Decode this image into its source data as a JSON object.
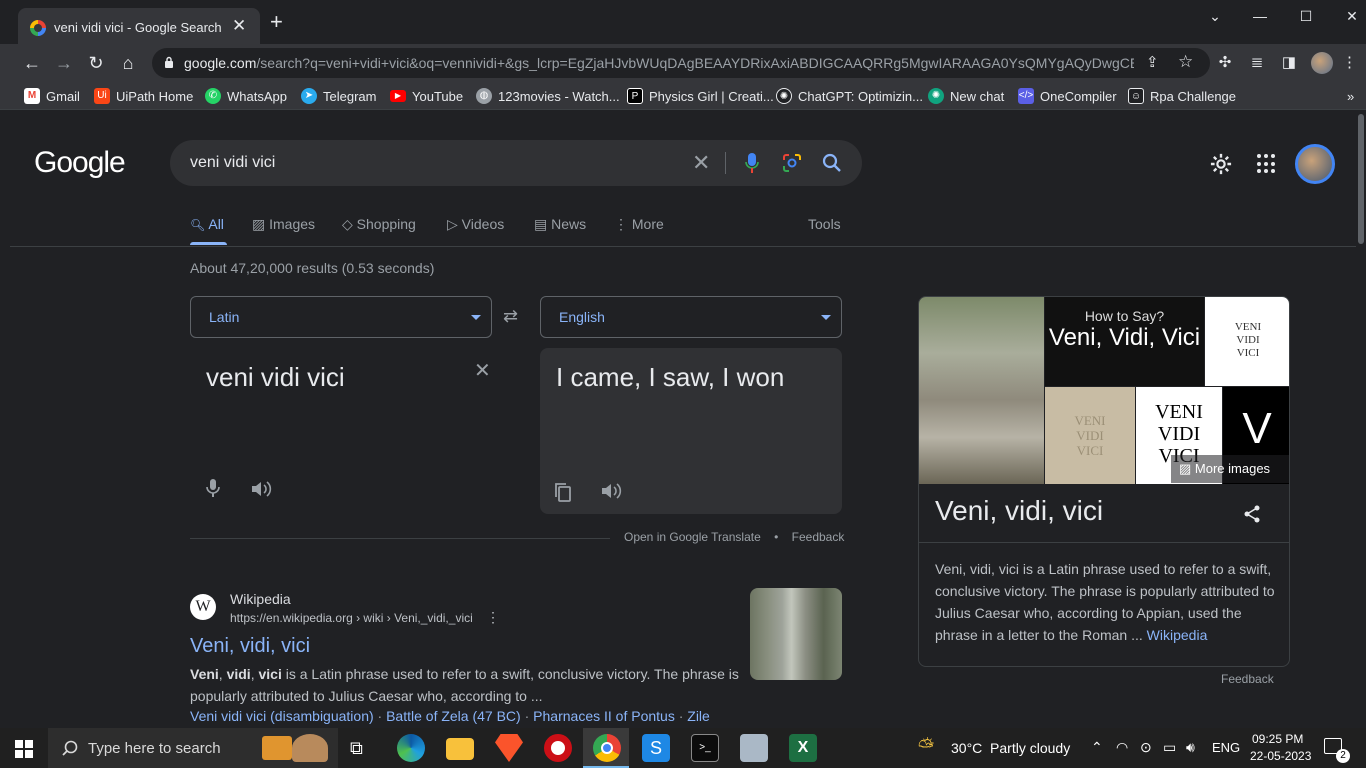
{
  "browser": {
    "tab_title": "veni vidi vici - Google Search",
    "url_host": "google.com",
    "url_path": "/search?q=veni+vidi+vici&oq=vennividi+&gs_lcrp=EgZjaHJvbWUqDAgBEAAYDRixAxiABDIGCAAQRRg5MgwIARAAGA0YsQMYgAQyDwgCEA..."
  },
  "bookmarks": [
    {
      "label": "Gmail",
      "icon": "gmail-icon",
      "color": "#ea4335"
    },
    {
      "label": "UiPath Home",
      "icon": "uipath-icon",
      "color": "#fa4616"
    },
    {
      "label": "WhatsApp",
      "icon": "whatsapp-icon",
      "color": "#25d366"
    },
    {
      "label": "Telegram",
      "icon": "telegram-icon",
      "color": "#2aabee"
    },
    {
      "label": "YouTube",
      "icon": "youtube-icon",
      "color": "#ff0000"
    },
    {
      "label": "123movies - Watch...",
      "icon": "globe-icon",
      "color": "#9aa0a6"
    },
    {
      "label": "Physics Girl | Creati...",
      "icon": "patreon-icon",
      "color": "#000000"
    },
    {
      "label": "ChatGPT: Optimizin...",
      "icon": "openai-icon",
      "color": "#202124"
    },
    {
      "label": "New chat",
      "icon": "openai-icon",
      "color": "#10a37f"
    },
    {
      "label": "OneCompiler",
      "icon": "code-icon",
      "color": "#5b5fe6"
    },
    {
      "label": "Rpa Challenge",
      "icon": "robot-icon",
      "color": "#202124"
    }
  ],
  "logo": "Google",
  "search": {
    "query": "veni vidi vici"
  },
  "tabs": [
    {
      "label": "All",
      "icon": "search-icon"
    },
    {
      "label": "Images",
      "icon": "image-icon"
    },
    {
      "label": "Shopping",
      "icon": "tag-icon"
    },
    {
      "label": "Videos",
      "icon": "play-icon"
    },
    {
      "label": "News",
      "icon": "news-icon"
    },
    {
      "label": "More",
      "icon": "more-vert-icon"
    }
  ],
  "tools_label": "Tools",
  "stats": "About 47,20,000 results (0.53 seconds)",
  "translate": {
    "source_lang": "Latin",
    "target_lang": "English",
    "source_text": "veni vidi vici",
    "target_text": "I came, I saw, I won",
    "open_link": "Open in Google Translate",
    "dot": "•",
    "feedback": "Feedback"
  },
  "result": {
    "site": "Wikipedia",
    "url": "https://en.wikipedia.org › wiki › Veni,_vidi,_vici",
    "title": "Veni, vidi, vici",
    "snippet_b1": "Veni",
    "snippet_c1": ", ",
    "snippet_b2": "vidi",
    "snippet_c2": ", ",
    "snippet_b3": "vici",
    "snippet_rest": " is a Latin phrase used to refer to a swift, conclusive victory. The phrase is popularly attributed to Julius Caesar who, according to ...",
    "links": [
      "Veni vidi vici (disambiguation)",
      "Battle of Zela (47 BC)",
      "Pharnaces II of Pontus",
      "Zile"
    ],
    "link_sep": "·"
  },
  "knowledge_panel": {
    "img_how": "How to Say?",
    "img_title": "Veni, Vidi, Vici",
    "img_badge_lines": [
      "VENI",
      "VIDI",
      "VICI"
    ],
    "img_stone": [
      "VENI",
      "VIDI",
      "VICI"
    ],
    "img_big": [
      "VENI",
      "VIDI",
      "VICI"
    ],
    "more_images": "More images",
    "title": "Veni, vidi, vici",
    "description": "Veni, vidi, vici is a Latin phrase used to refer to a swift, conclusive victory. The phrase is popularly attributed to Julius Caesar who, according to Appian, used the phrase in a letter to the Roman ... ",
    "source_link": "Wikipedia",
    "feedback": "Feedback"
  },
  "taskbar": {
    "search_placeholder": "Type here to search",
    "weather": "30°C  Partly cloudy",
    "lang": "ENG",
    "time": "09:25 PM",
    "date": "22-05-2023",
    "notif_count": "2"
  }
}
